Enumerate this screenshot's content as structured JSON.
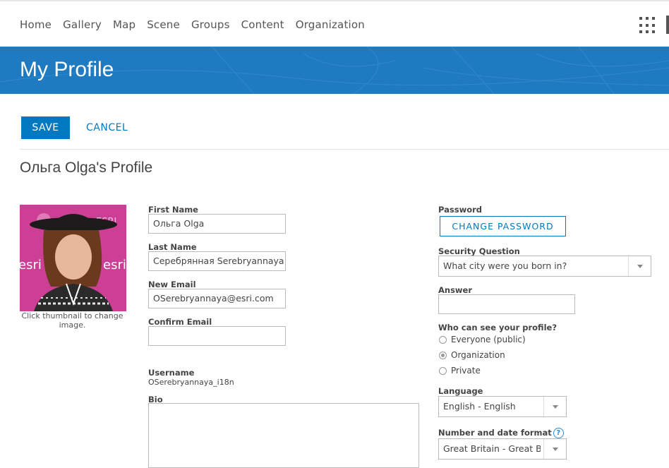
{
  "nav": {
    "items": [
      "Home",
      "Gallery",
      "Map",
      "Scene",
      "Groups",
      "Content",
      "Organization"
    ],
    "apps_icon": "app-launcher-grid-icon"
  },
  "banner": {
    "title": "My Profile"
  },
  "actions": {
    "save": "SAVE",
    "cancel": "CANCEL"
  },
  "profile": {
    "heading": "Ольга Olga's Profile",
    "thumbnail_caption": "Click thumbnail to change image.",
    "thumbnail_text": [
      "esri",
      "esri",
      "ESRI"
    ]
  },
  "form": {
    "first_name": {
      "label": "First Name",
      "value": "Ольга Olga"
    },
    "last_name": {
      "label": "Last Name",
      "value": "Серебрянная Serebryannaya"
    },
    "new_email": {
      "label": "New Email",
      "value": "OSerebryannaya@esri.com"
    },
    "confirm_email": {
      "label": "Confirm Email",
      "value": ""
    },
    "username": {
      "label": "Username",
      "value": "OSerebryannaya_i18n"
    },
    "bio": {
      "label": "Bio",
      "value": ""
    }
  },
  "right": {
    "password": {
      "label": "Password",
      "button": "CHANGE PASSWORD"
    },
    "security_question": {
      "label": "Security Question",
      "value": "What city were you born in?"
    },
    "answer": {
      "label": "Answer",
      "value": ""
    },
    "visibility": {
      "label": "Who can see your profile?",
      "options": [
        "Everyone (public)",
        "Organization",
        "Private"
      ],
      "selected": "Organization"
    },
    "language": {
      "label": "Language",
      "value": "English - English"
    },
    "format": {
      "label": "Number and date format",
      "value": "Great Britain - Great B",
      "help_icon": "question-circle-icon"
    }
  },
  "colors": {
    "accent": "#0079c1",
    "banner": "#1f7bc1",
    "thumbnail_bg": "#cc3f95"
  }
}
